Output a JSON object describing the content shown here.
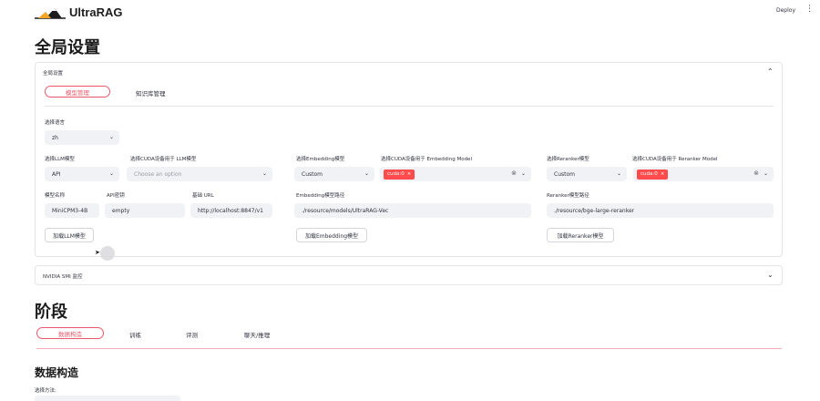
{
  "app": {
    "logo_text": "UltraRAG",
    "deploy_label": "Deploy",
    "menu_glyph": "⋮",
    "accent_color": "#e8586b",
    "tag_color": "#ff4b4b"
  },
  "page_title": "全局设置",
  "global_expander": {
    "header": "全局设置",
    "tabs": [
      {
        "label": "模型管理",
        "active": true
      },
      {
        "label": "知识库管理",
        "active": false
      }
    ],
    "language": {
      "label": "选择语言",
      "value": "zh"
    },
    "llm": {
      "model_label": "选择LLM模型",
      "model_value": "API",
      "cuda_label": "选择CUDA设备用于 LLM模型",
      "cuda_placeholder": "Choose an option",
      "name_label": "模型名称",
      "name_value": "MiniCPM3-4B",
      "key_label": "API密钥",
      "key_value": "empty",
      "url_label": "基础 URL",
      "url_value": "http://localhost:8847/v1",
      "load_button": "加载LLM模型"
    },
    "embedding": {
      "model_label": "选择Embedding模型",
      "model_value": "Custom",
      "cuda_label": "选择CUDA设备用于 Embedding Model",
      "cuda_tag": "cuda:0",
      "path_label": "Embedding模型路径",
      "path_value": "./resource/models/UltraRAG-Vec",
      "load_button": "加载Embedding模型"
    },
    "reranker": {
      "model_label": "选择Reranker模型",
      "model_value": "Custom",
      "cuda_label": "选择CUDA设备用于 Reranker Model",
      "cuda_tag": "cuda:0",
      "path_label": "Reranker模型路径",
      "path_value": "./resource/bge-large-reranker",
      "load_button": "加载Reranker模型"
    }
  },
  "nvidia_expander": {
    "header": "NVIDIA SMI 监控"
  },
  "stage": {
    "title": "阶段",
    "tabs": [
      {
        "label": "数据构造",
        "active": true
      },
      {
        "label": "训练",
        "active": false
      },
      {
        "label": "评测",
        "active": false
      },
      {
        "label": "聊天/推理",
        "active": false
      }
    ]
  },
  "data_section": {
    "title": "数据构造",
    "method_label": "选择方法:"
  }
}
